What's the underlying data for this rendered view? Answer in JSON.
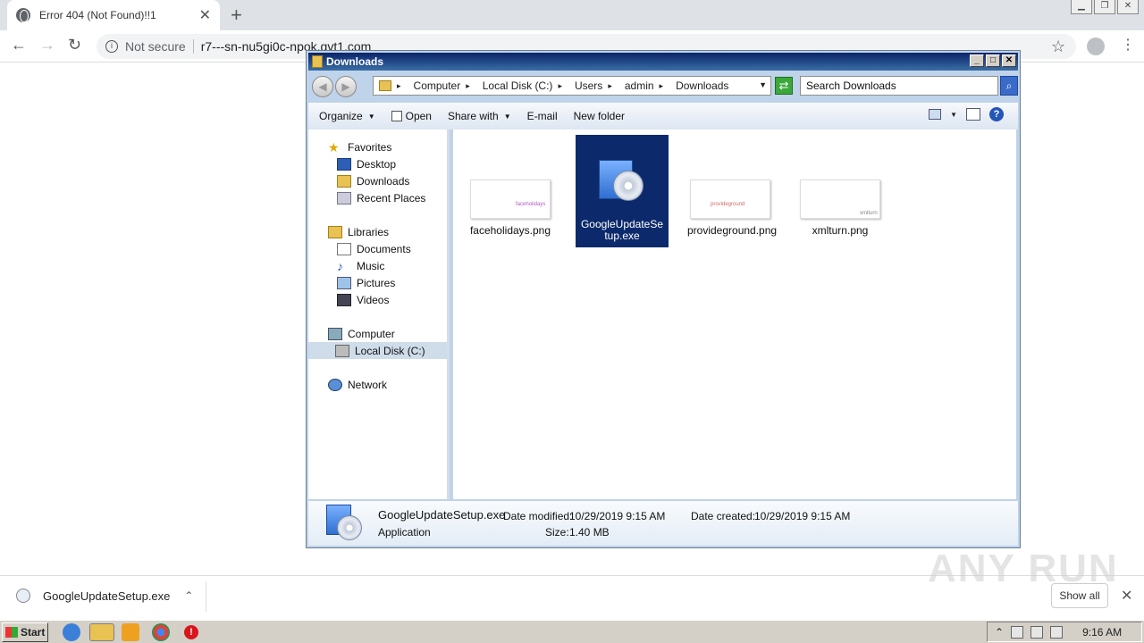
{
  "browser": {
    "tab_title": "Error 404 (Not Found)!!1",
    "tab_close": "✕",
    "new_tab": "+",
    "security": "Not secure",
    "url": "r7---sn-nu5gi0c-npok.gvt1.com"
  },
  "explorer": {
    "title": "Downloads",
    "breadcrumbs": [
      "Computer",
      "Local Disk (C:)",
      "Users",
      "admin",
      "Downloads"
    ],
    "search_placeholder": "Search Downloads",
    "commands": {
      "organize": "Organize",
      "open": "Open",
      "share_with": "Share with",
      "email": "E-mail",
      "new_folder": "New folder"
    },
    "nav": {
      "favorites": "Favorites",
      "desktop": "Desktop",
      "downloads": "Downloads",
      "recent_places": "Recent Places",
      "libraries": "Libraries",
      "documents": "Documents",
      "music": "Music",
      "pictures": "Pictures",
      "videos": "Videos",
      "computer": "Computer",
      "local_disk": "Local Disk (C:)",
      "network": "Network"
    },
    "files": [
      {
        "name": "faceholidays.png",
        "thumb_text": "faceholidays"
      },
      {
        "name": "GoogleUpdateSetup.exe"
      },
      {
        "name": "provideground.png",
        "thumb_text": "provideground"
      },
      {
        "name": "xmlturn.png",
        "thumb_text": "xmlturn"
      }
    ],
    "details": {
      "name": "GoogleUpdateSetup.exe",
      "type": "Application",
      "modified_label": "Date modified:",
      "modified_value": "10/29/2019 9:15 AM",
      "created_label": "Date created:",
      "created_value": "10/29/2019 9:15 AM",
      "size_label": "Size:",
      "size_value": "1.40 MB"
    }
  },
  "downloads_bar": {
    "file": "GoogleUpdateSetup.exe",
    "show_all": "Show all"
  },
  "watermark": "ANY RUN",
  "taskbar": {
    "start": "Start",
    "clock": "9:16 AM"
  },
  "colors": {
    "selection": "#0c2a6b",
    "title_bar": "#0a246a",
    "taskbar": "#d4d0c8"
  }
}
